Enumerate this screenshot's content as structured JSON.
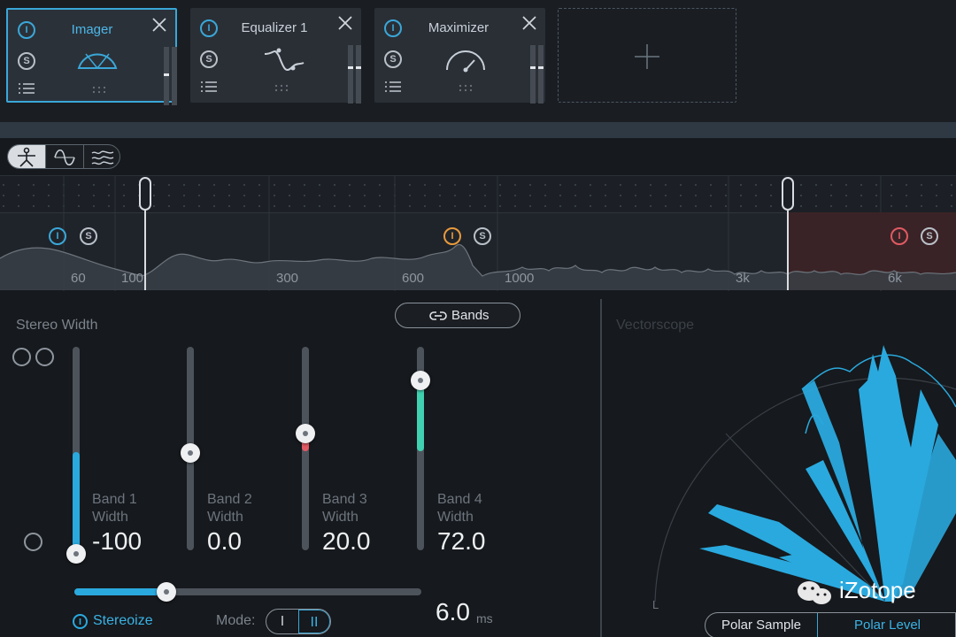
{
  "modules": [
    {
      "title": "Imager",
      "power_glyph": "I",
      "solo_glyph": "S"
    },
    {
      "title": "Equalizer 1",
      "power_glyph": "I",
      "solo_glyph": "S"
    },
    {
      "title": "Maximizer",
      "power_glyph": "I",
      "solo_glyph": "S"
    }
  ],
  "spectrum": {
    "band_power_glyph": "I",
    "band_solo_glyph": "S",
    "freq_labels": [
      "60",
      "100",
      "300",
      "600",
      "1000",
      "3k",
      "6k"
    ]
  },
  "stereo": {
    "title": "Stereo Width",
    "bands_button": "Bands",
    "bands": [
      {
        "label_line1": "Band 1",
        "label_line2": "Width",
        "value": "-100",
        "level": 0.0
      },
      {
        "label_line1": "Band 2",
        "label_line2": "Width",
        "value": "0.0",
        "level": 0.5
      },
      {
        "label_line1": "Band 3",
        "label_line2": "Width",
        "value": "20.0",
        "level": 0.6
      },
      {
        "label_line1": "Band 4",
        "label_line2": "Width",
        "value": "72.0",
        "level": 0.86
      }
    ],
    "stereoize_label": "Stereoize",
    "mode_label": "Mode:",
    "mode_options": [
      "I",
      "II"
    ],
    "mode_selected": "II",
    "delay_value": "6.0",
    "delay_unit": "ms",
    "delay_level": 0.27
  },
  "vectorscope": {
    "title": "Vectorscope",
    "axis_left": "L",
    "polar_sample": "Polar Sample",
    "polar_level": "Polar Level"
  },
  "watermark": "iZotope",
  "colors": {
    "accent": "#2aa9de",
    "band3_fill": "#e05a64",
    "band4_fill": "#3fd1b0",
    "band4_tint": "#3a2326",
    "band2_power": "#e89a3c",
    "band4_power": "#e05a64"
  }
}
